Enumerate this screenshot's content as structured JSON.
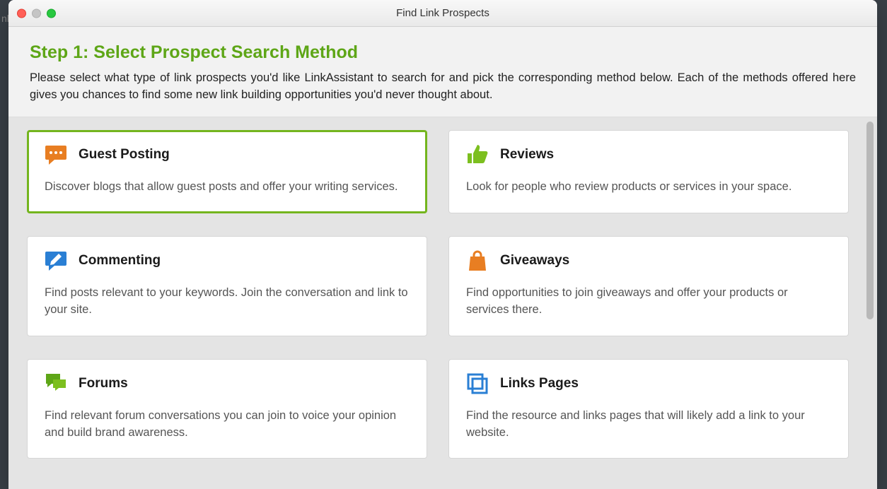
{
  "bgTab": "nk",
  "window": {
    "title": "Find Link Prospects",
    "step_title": "Step 1: Select Prospect Search Method",
    "step_desc": "Please select what type of link prospects you'd like LinkAssistant to search for and pick the corresponding method below. Each of the methods offered here gives you chances to find some new link building opportunities you'd never thought about."
  },
  "cards": [
    {
      "title": "Guest Posting",
      "desc": "Discover blogs that allow guest posts and offer your writing services."
    },
    {
      "title": "Reviews",
      "desc": "Look for people who review products or services in your space."
    },
    {
      "title": "Commenting",
      "desc": "Find posts relevant to your keywords. Join the conversation and link to your site."
    },
    {
      "title": "Giveaways",
      "desc": "Find opportunities to join giveaways and offer your products or services there."
    },
    {
      "title": "Forums",
      "desc": "Find relevant forum conversations you can join to voice your opinion and build brand awareness."
    },
    {
      "title": "Links Pages",
      "desc": "Find the resource and links pages that will likely add a link to your website."
    }
  ]
}
